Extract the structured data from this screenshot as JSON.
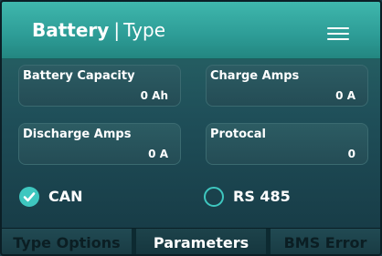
{
  "header": {
    "title_bold": "Battery",
    "separator": "|",
    "title_light": "Type"
  },
  "fields": {
    "battery_capacity": {
      "label": "Battery Capacity",
      "value": "0 Ah"
    },
    "charge_amps": {
      "label": "Charge Amps",
      "value": "0 A"
    },
    "discharge_amps": {
      "label": "Discharge Amps",
      "value": "0 A"
    },
    "protocol": {
      "label": "Protocal",
      "value": "0"
    }
  },
  "communication": {
    "options": [
      {
        "label": "CAN",
        "selected": true
      },
      {
        "label": "RS 485",
        "selected": false
      }
    ]
  },
  "tabs": [
    {
      "label": "Type Options",
      "active": false
    },
    {
      "label": "Parameters",
      "active": true
    },
    {
      "label": "BMS Error",
      "active": false
    }
  ],
  "colors": {
    "accent": "#3ec7bf",
    "header": "#2d9c96",
    "background": "#1f4f59"
  }
}
